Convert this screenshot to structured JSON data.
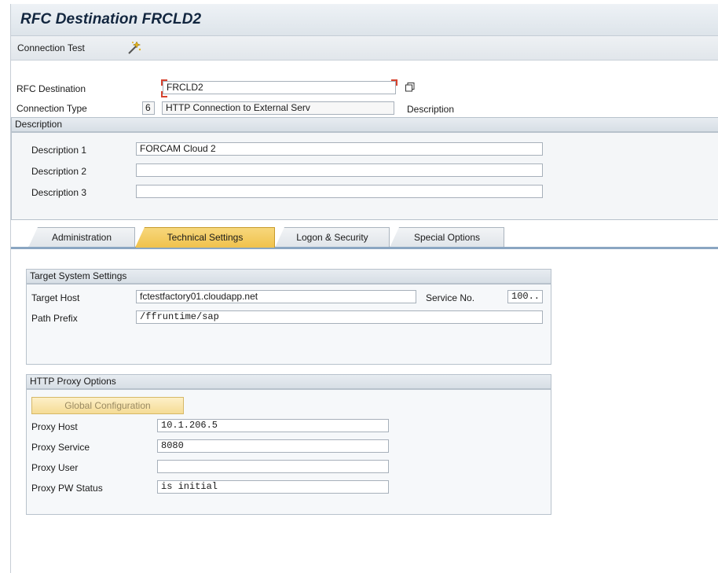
{
  "title": "RFC Destination FRCLD2",
  "toolbar": {
    "connection_test": "Connection Test",
    "wand_icon": "magic-wand-icon"
  },
  "header": {
    "rfc_destination_label": "RFC Destination",
    "rfc_destination_value": "FRCLD2",
    "connection_type_label": "Connection Type",
    "connection_type_code": "6",
    "connection_type_text": "HTTP Connection to External Serv",
    "description_link": "Description"
  },
  "description": {
    "header": "Description",
    "rows": [
      {
        "label": "Description 1",
        "value": "FORCAM Cloud 2"
      },
      {
        "label": "Description 2",
        "value": ""
      },
      {
        "label": "Description 3",
        "value": ""
      }
    ]
  },
  "tabs": [
    {
      "label": "Administration"
    },
    {
      "label": "Technical Settings"
    },
    {
      "label": "Logon & Security"
    },
    {
      "label": "Special Options"
    }
  ],
  "target": {
    "header": "Target System Settings",
    "host_label": "Target Host",
    "host_value": "fctestfactory01.cloudapp.net",
    "service_label": "Service No.",
    "service_value": "100..",
    "path_label": "Path Prefix",
    "path_value": "/ffruntime/sap"
  },
  "proxy": {
    "header": "HTTP Proxy Options",
    "global_button": "Global Configuration",
    "rows": [
      {
        "label": "Proxy Host",
        "value": "10.1.206.5"
      },
      {
        "label": "Proxy Service",
        "value": "8080"
      },
      {
        "label": "Proxy User",
        "value": ""
      },
      {
        "label": "Proxy PW Status",
        "value": "is initial"
      }
    ]
  },
  "colors": {
    "active_tab": "#f0c24c",
    "title_text": "#12263f",
    "tab_line": "#8aa6c2"
  }
}
